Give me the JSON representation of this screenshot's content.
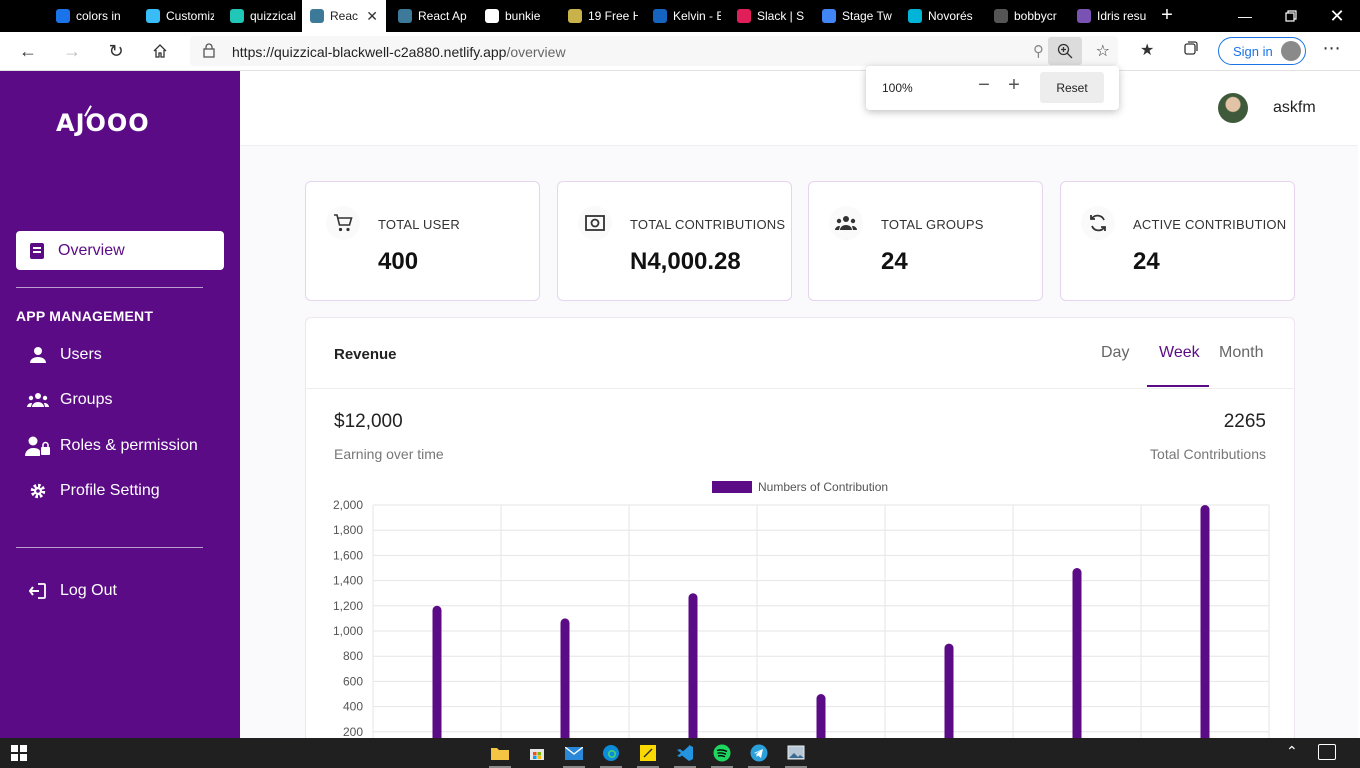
{
  "browser": {
    "tabs": [
      {
        "title": "colors in",
        "favicon_color": "#1a73e8",
        "icon": "bing-icon"
      },
      {
        "title": "Customiz",
        "favicon_color": "#38bdf8",
        "icon": "tailwind-icon"
      },
      {
        "title": "quizzical",
        "favicon_color": "#20c6b6",
        "icon": "netlify-icon"
      },
      {
        "title": "Reac",
        "favicon_color": "#3d7a9a",
        "icon": "react-icon",
        "active": true
      },
      {
        "title": "React Ap",
        "favicon_color": "#3d7a9a",
        "icon": "react-icon"
      },
      {
        "title": "bunkie",
        "favicon_color": "#ffffff",
        "icon": "document-icon"
      },
      {
        "title": "19 Free H",
        "favicon_color": "#c9b24a",
        "icon": "go-icon"
      },
      {
        "title": "Kelvin - E",
        "favicon_color": "#1565c0",
        "icon": "kelvin-icon"
      },
      {
        "title": "Slack | S",
        "favicon_color": "#e01e5a",
        "icon": "slack-icon"
      },
      {
        "title": "Stage Tw",
        "favicon_color": "#4285f4",
        "icon": "google-docs-icon"
      },
      {
        "title": "Novorés",
        "favicon_color": "#00b4d8",
        "icon": "novoresume-icon"
      },
      {
        "title": "bobbycr",
        "favicon_color": "#555555",
        "icon": "github-icon"
      },
      {
        "title": "Idris resu",
        "favicon_color": "#7952b3",
        "icon": "bootstrap-icon"
      }
    ],
    "address": {
      "host": "https://quizzical-blackwell-c2a880.netlify.app",
      "path": "/overview"
    },
    "signin_label": "Sign in",
    "zoom": {
      "level": "100%",
      "reset_label": "Reset"
    }
  },
  "sidebar": {
    "logo": "AJOOO",
    "active_item": "Overview",
    "section_title": "APP MANAGEMENT",
    "items": [
      {
        "label": "Users",
        "icon": "user-icon"
      },
      {
        "label": "Groups",
        "icon": "groups-icon"
      },
      {
        "label": "Roles & permission",
        "icon": "roles-icon"
      },
      {
        "label": "Profile Setting",
        "icon": "gear-icon"
      }
    ],
    "logout_label": "Log Out"
  },
  "header": {
    "username": "askfm"
  },
  "stats": [
    {
      "label": "TOTAL USER",
      "value": "400",
      "icon": "cart-icon"
    },
    {
      "label": "TOTAL CONTRIBUTIONS",
      "value": "N4,000.28",
      "icon": "cash-icon"
    },
    {
      "label": "TOTAL GROUPS",
      "value": "24",
      "icon": "groups-icon"
    },
    {
      "label": "ACTIVE CONTRIBUTION",
      "value": "24",
      "icon": "refresh-icon"
    }
  ],
  "revenue": {
    "title": "Revenue",
    "tabs": [
      "Day",
      "Week",
      "Month"
    ],
    "active_tab": "Week",
    "amount": "$12,000",
    "amount_label": "Earning over time",
    "total": "2265",
    "total_label": "Total Contributions"
  },
  "chart_data": {
    "type": "bar",
    "series": [
      {
        "name": "Numbers of Contribution",
        "values": [
          1200,
          1100,
          1300,
          500,
          900,
          1500,
          2000
        ]
      }
    ],
    "y_ticks": [
      200,
      400,
      600,
      800,
      1000,
      1200,
      1400,
      1600,
      1800,
      2000
    ],
    "ylim": [
      0,
      2000
    ],
    "grid": true,
    "legend_position": "top",
    "bar_color": "#5b0b86"
  },
  "taskbar": {
    "apps": [
      "file-explorer-icon",
      "store-icon",
      "mail-icon",
      "edge-icon",
      "sticky-notes-icon",
      "vscode-icon",
      "spotify-icon",
      "telegram-icon",
      "photos-icon"
    ]
  }
}
